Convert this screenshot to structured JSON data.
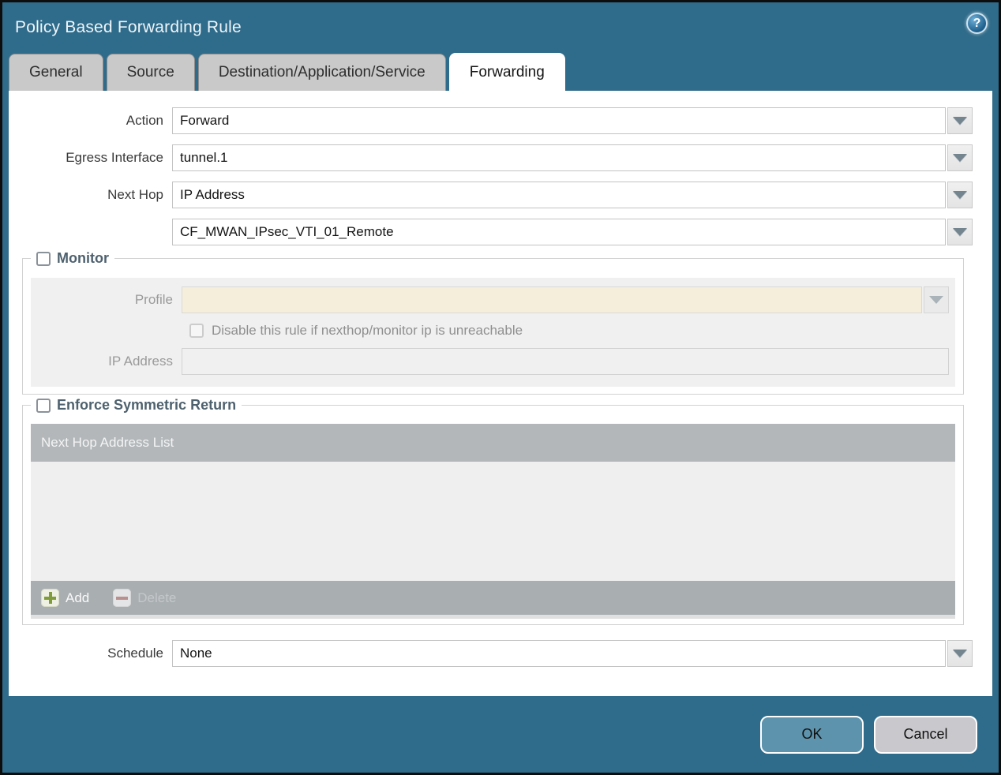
{
  "window": {
    "title": "Policy Based Forwarding Rule",
    "help_icon": "?"
  },
  "tabs": [
    {
      "label": "General",
      "active": false
    },
    {
      "label": "Source",
      "active": false
    },
    {
      "label": "Destination/Application/Service",
      "active": false
    },
    {
      "label": "Forwarding",
      "active": true
    }
  ],
  "form": {
    "action": {
      "label": "Action",
      "value": "Forward"
    },
    "egress_interface": {
      "label": "Egress Interface",
      "value": "tunnel.1"
    },
    "next_hop": {
      "label": "Next Hop",
      "value": "IP Address"
    },
    "next_hop_address": {
      "value": "CF_MWAN_IPsec_VTI_01_Remote"
    },
    "schedule": {
      "label": "Schedule",
      "value": "None"
    }
  },
  "monitor": {
    "legend": "Monitor",
    "checked": false,
    "profile": {
      "label": "Profile",
      "value": ""
    },
    "disable_rule": {
      "label": "Disable this rule if nexthop/monitor ip is unreachable",
      "checked": false
    },
    "ip_address": {
      "label": "IP Address",
      "value": ""
    }
  },
  "symmetric_return": {
    "legend": "Enforce Symmetric Return",
    "checked": false,
    "table": {
      "header": "Next Hop Address List",
      "rows": []
    },
    "toolbar": {
      "add_label": "Add",
      "delete_label": "Delete",
      "delete_enabled": false
    }
  },
  "footer": {
    "ok_label": "OK",
    "cancel_label": "Cancel"
  },
  "colors": {
    "titlebar_teal": "#2f6b8a",
    "active_tab_bg": "#ffffff",
    "inactive_tab_bg": "#c9c9c9",
    "disabled_field_beige": "#f5eeda",
    "table_header_gray": "#b3b7ba",
    "toolbar_gray": "#a9aeb1",
    "ok_button_bg": "#5e93ad",
    "cancel_button_bg": "#c9c9cd",
    "add_icon_green": "#7f9b3a",
    "delete_icon_red": "#b99090",
    "legend_text": "#4e616e"
  }
}
